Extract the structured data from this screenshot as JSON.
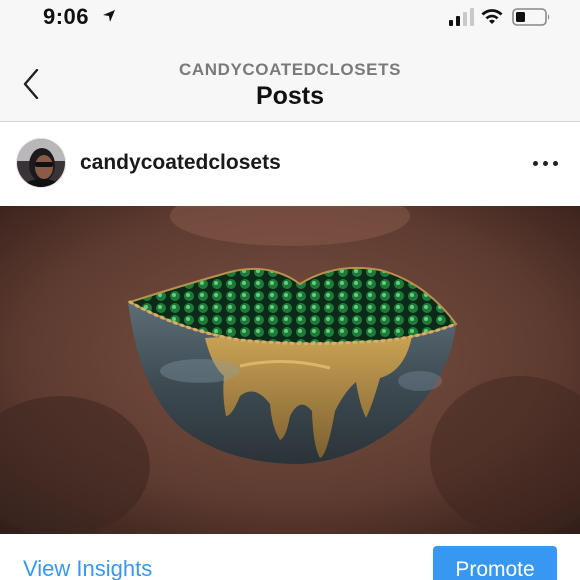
{
  "status_bar": {
    "time": "9:06",
    "icons": [
      "location-arrow-icon",
      "cellular-signal-icon",
      "wifi-icon",
      "battery-icon"
    ]
  },
  "nav": {
    "subtitle": "CANDYCOATEDCLOSETS",
    "title": "Posts",
    "back_icon": "chevron-left-icon"
  },
  "post": {
    "username": "candycoatedclosets",
    "more_icon": "ellipsis-icon",
    "image_subject": "lip art with green rhinestones and gold drips"
  },
  "actions": {
    "insights_label": "View Insights",
    "promote_label": "Promote"
  },
  "colors": {
    "accent": "#3897f0",
    "header_bg": "#f7f7f7",
    "divider": "#d6d6d6"
  }
}
